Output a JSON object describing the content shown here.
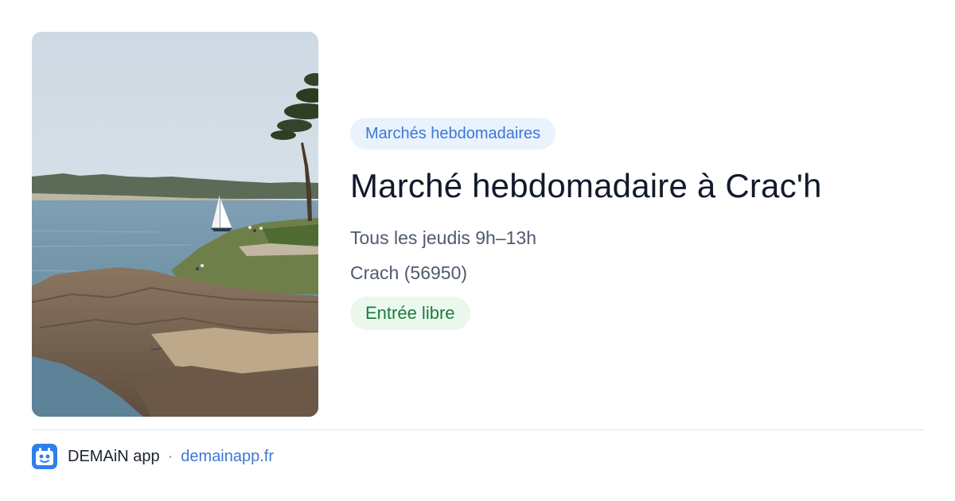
{
  "event": {
    "category": "Marchés hebdomadaires",
    "title": "Marché hebdomadaire à Crac'h",
    "schedule": "Tous les jeudis 9h–13h",
    "location": "Crach (56950)",
    "price": "Entrée libre",
    "photo_icon": "coastal-landscape-photo"
  },
  "footer": {
    "logo_icon": "demain-app-logo-icon",
    "app_name": "DEMAiN app",
    "separator": "·",
    "link_text": "demainapp.fr"
  },
  "colors": {
    "category_text": "#3b78d4",
    "category_bg": "#eaf2fd",
    "price_text": "#1d7c3e",
    "price_bg": "#eaf8ee",
    "title": "#111a2c",
    "meta_text": "#4f5a6c",
    "link": "#3b78d4",
    "logo_bg": "#2f80ed"
  }
}
